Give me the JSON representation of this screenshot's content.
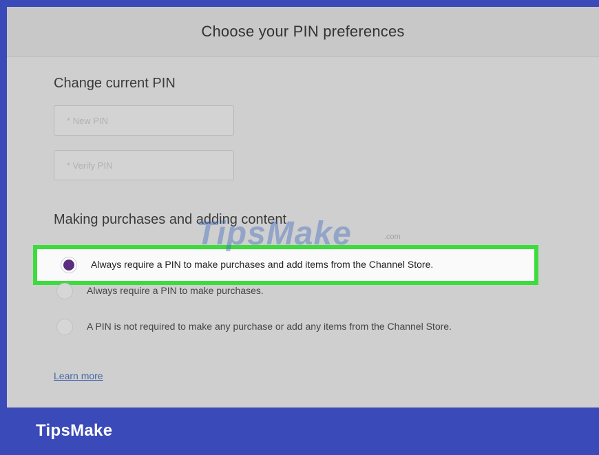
{
  "header": {
    "title": "Choose your PIN preferences"
  },
  "change_pin": {
    "title": "Change current PIN",
    "new_pin_placeholder": "* New PIN",
    "verify_pin_placeholder": "* Verify PIN"
  },
  "purchases": {
    "title": "Making purchases and adding content",
    "options": [
      {
        "label": "Always require a PIN to make purchases and add items from the Channel Store.",
        "selected": true
      },
      {
        "label": "Always require a PIN to make purchases.",
        "selected": false
      },
      {
        "label": "A PIN is not required to make any purchase or add any items from the Channel Store.",
        "selected": false
      }
    ],
    "learn_more": "Learn more"
  },
  "watermark": {
    "text": "TipsMake",
    "suffix": ".com"
  },
  "brand": {
    "name": "TipsMake"
  },
  "colors": {
    "highlight_border": "#3ddc3d",
    "selected_radio": "#5a2d7d",
    "brand_bar": "#3a4ab8"
  }
}
